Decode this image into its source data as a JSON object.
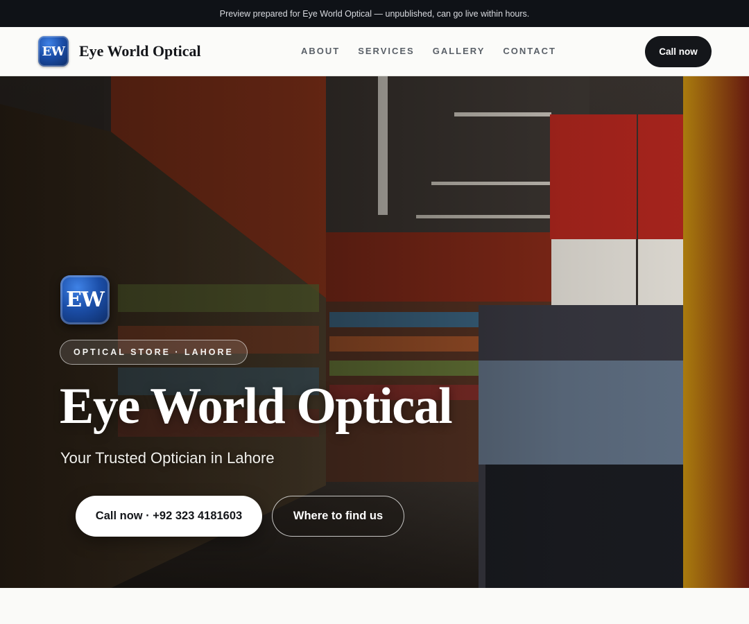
{
  "preview_banner": {
    "text": "Preview prepared for Eye World Optical — unpublished, can go live within hours."
  },
  "header": {
    "logo_text": "EW",
    "brand_name": "Eye World Optical",
    "nav": [
      {
        "label": "ABOUT"
      },
      {
        "label": "SERVICES"
      },
      {
        "label": "GALLERY"
      },
      {
        "label": "CONTACT"
      }
    ],
    "cta_label": "Call now"
  },
  "hero": {
    "background_image": "supermarket-aisle-photo",
    "logo_text": "EW",
    "eyebrow": "OPTICAL STORE · LAHORE",
    "title": "Eye World Optical",
    "subtitle": "Your Trusted Optician in Lahore",
    "primary_button": "Call now · +92 323 4181603",
    "secondary_button": "Where to find us"
  },
  "colors": {
    "dark": "#14161a",
    "banner_bg": "#0f1217",
    "logo_blue": "#1b4ea8",
    "page_bg": "#fafaf8"
  }
}
